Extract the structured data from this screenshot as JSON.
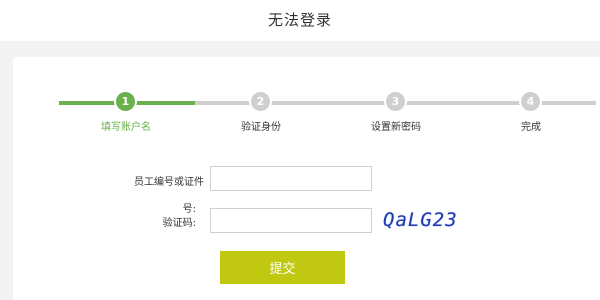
{
  "header": {
    "title": "无法登录"
  },
  "steps": [
    {
      "number": "1",
      "label": "填写账户名",
      "state": "active"
    },
    {
      "number": "2",
      "label": "验证身份",
      "state": "pending"
    },
    {
      "number": "3",
      "label": "设置新密码",
      "state": "pending"
    },
    {
      "number": "4",
      "label": "完成",
      "state": "pending"
    }
  ],
  "form": {
    "account_label_line1": "员工编号或证件",
    "account_label_line2": "号:",
    "account_value": "",
    "captcha_label": "验证码:",
    "captcha_value": "",
    "captcha_text": "QaLG23",
    "submit_label": "提交"
  },
  "colors": {
    "accent_green": "#6ab04c",
    "submit_button": "#c0c812",
    "captcha_text": "#1f3bb3",
    "inactive_step": "#cfcfcf"
  }
}
